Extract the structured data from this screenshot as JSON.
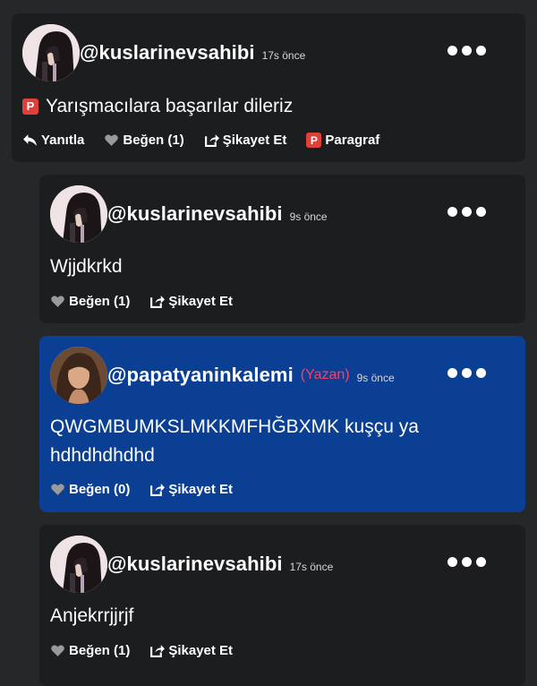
{
  "comments": [
    {
      "username": "@kuslarinevsahibi",
      "time": "17s önce",
      "text": "Yarışmacılara başarılar dileriz",
      "badge_letter": "P",
      "actions": {
        "reply": "Yanıtla",
        "like": "Beğen (1)",
        "report": "Şikayet Et",
        "paragraph": "Paragraf"
      }
    },
    {
      "username": "@kuslarinevsahibi",
      "time": "9s önce",
      "text": "Wjjdkrkd",
      "actions": {
        "like": "Beğen (1)",
        "report": "Şikayet Et"
      }
    },
    {
      "username": "@papatyaninkalemi",
      "role": "(Yazan)",
      "time": "9s önce",
      "text_line1": "QWGMBUMKSLMKKMFHĞBXMK kuşçu ya",
      "text_line2": "hdhdhdhdhd",
      "actions": {
        "like": "Beğen (0)",
        "report": "Şikayet Et"
      }
    },
    {
      "username": "@kuslarinevsahibi",
      "time": "17s önce",
      "text": "Anjekrrjjrjf",
      "actions": {
        "like": "Beğen (1)",
        "report": "Şikayet Et"
      }
    }
  ],
  "colors": {
    "background": "#262729",
    "card": "#1c1d1f",
    "highlight": "#0b3f94",
    "role": "#f0446b",
    "badge": "#e0403a"
  },
  "icons": [
    "reply-icon",
    "heart-icon",
    "share-report-icon",
    "paragraph-badge-icon",
    "more-dots-icon"
  ]
}
